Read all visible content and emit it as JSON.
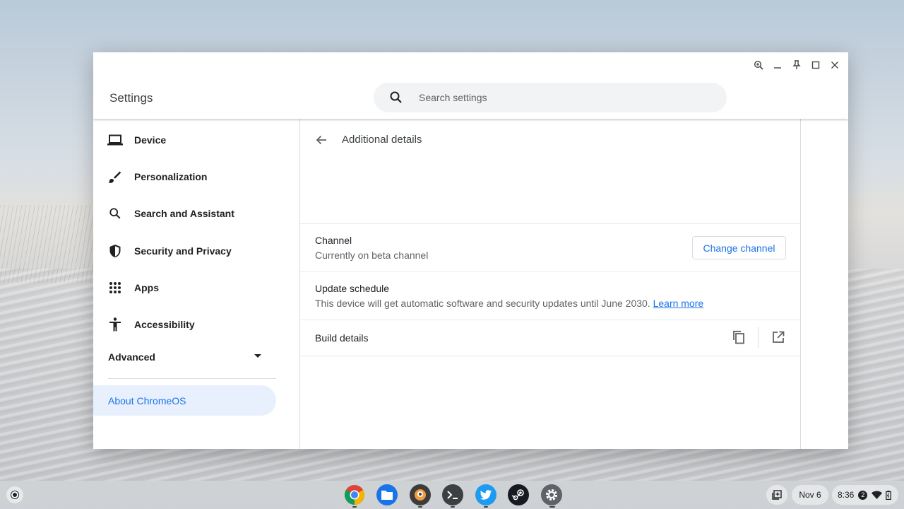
{
  "window": {
    "app_title": "Settings",
    "search": {
      "placeholder": "Search settings"
    }
  },
  "sidebar": {
    "items": [
      {
        "label": "Device",
        "icon": "laptop-icon"
      },
      {
        "label": "Personalization",
        "icon": "brush-icon"
      },
      {
        "label": "Search and Assistant",
        "icon": "search-icon"
      },
      {
        "label": "Security and Privacy",
        "icon": "shield-icon"
      },
      {
        "label": "Apps",
        "icon": "apps-grid-icon"
      },
      {
        "label": "Accessibility",
        "icon": "accessibility-icon"
      }
    ],
    "advanced_label": "Advanced",
    "about_label": "About ChromeOS"
  },
  "content": {
    "page_title": "Additional details",
    "channel": {
      "title": "Channel",
      "subtitle": "Currently on beta channel",
      "button": "Change channel"
    },
    "update_schedule": {
      "title": "Update schedule",
      "subtitle": "This device will get automatic software and security updates until June 2030.",
      "link": "Learn more"
    },
    "build_details": {
      "title": "Build details"
    }
  },
  "shelf": {
    "apps": [
      "chrome-icon",
      "files-icon",
      "cantor-icon",
      "terminal-icon",
      "twitter-icon",
      "steam-icon",
      "settings-icon"
    ],
    "date": "Nov 6",
    "time": "8:36",
    "notification_count": "2"
  },
  "colors": {
    "accent": "#1a73e8",
    "selected_bg": "#e8f0fe"
  }
}
